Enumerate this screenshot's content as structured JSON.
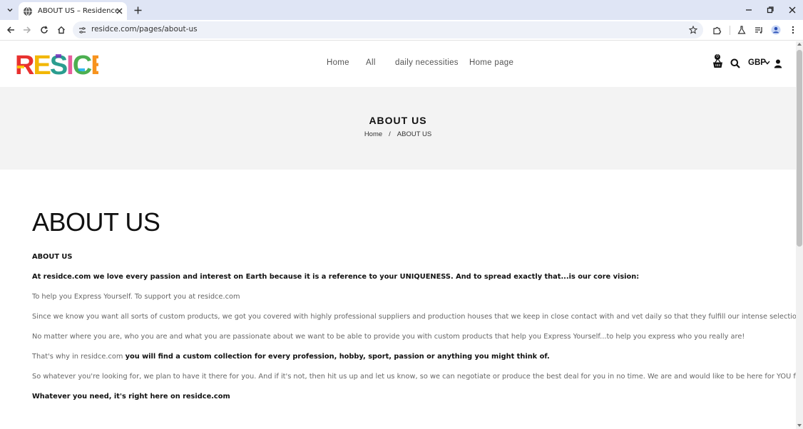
{
  "browser": {
    "tab_title": "ABOUT US – Residence Royale",
    "url": "residce.com/pages/about-us"
  },
  "site": {
    "logo_text": "RESICE",
    "nav": [
      "Home",
      "All",
      "daily necessities",
      "Home page"
    ],
    "cart_count": "0",
    "currency": "GBP"
  },
  "hero": {
    "title": "ABOUT US",
    "breadcrumb_home": "Home",
    "breadcrumb_sep": "/",
    "breadcrumb_current": "ABOUT US"
  },
  "content": {
    "heading": "ABOUT US",
    "subheading": "ABOUT US",
    "p1": "At residce.com  we love every passion and interest on Earth because it is a reference to your UNIQUENESS. And to spread exactly that...is our core vision:",
    "p2": "To help you Express Yourself. To support you at residce.com",
    "p3": "Since we know you want all sorts of custom products, we got you covered with highly professional suppliers and production houses that we keep in close contact with and vet daily so that they fulfill our intense selection process.",
    "p4": "No matter where you are, who you are and what you are passionate about we want to be able to provide you with custom products that help you Express Yourself...to help you express who you really are!",
    "p5_normal": "That's why in residce.com ",
    "p5_bold": "you will find a custom collection for every profession, hobby, sport, passion or anything you might think of.",
    "p6": "So whatever you're looking for, we plan to have it there for you. And if it's not, then hit us up and let us know, so we can negotiate or produce the best deal for you in no time. We are and would like to be here for YOU for a lifetime.",
    "p7": "Whatever you need, it's right here on  residce.com"
  }
}
